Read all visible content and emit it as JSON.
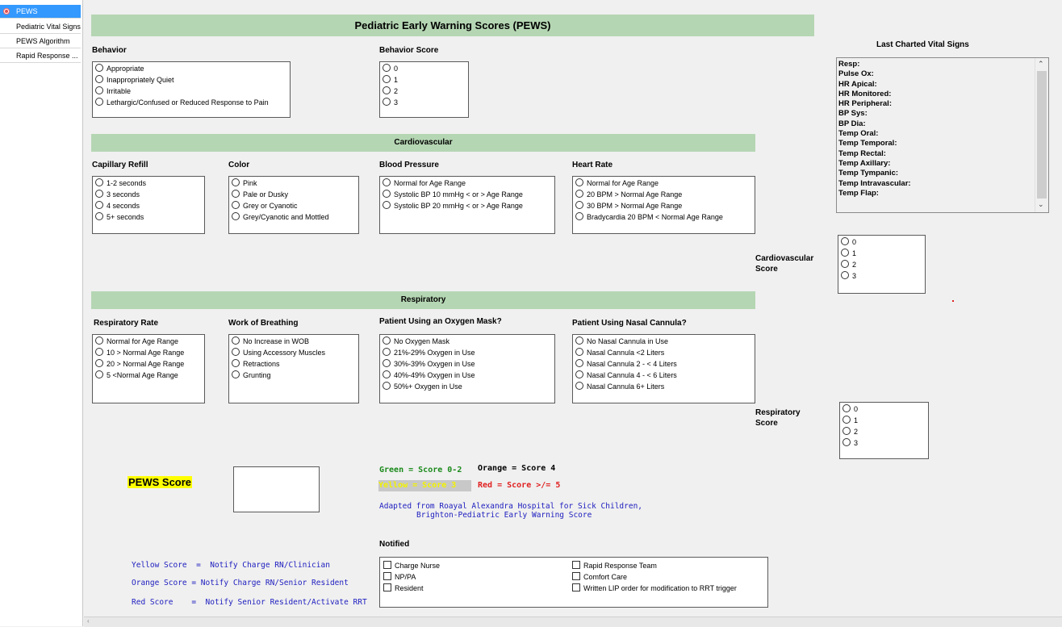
{
  "nav": {
    "items": [
      {
        "label": "PEWS",
        "active": true
      },
      {
        "label": "Pediatric Vital Signs"
      },
      {
        "label": "PEWS Algorithm"
      },
      {
        "label": "Rapid Response ..."
      }
    ]
  },
  "title": "Pediatric Early Warning Scores (PEWS)",
  "behavior": {
    "label": "Behavior",
    "options": [
      "Appropriate",
      "Inappropriately Quiet",
      "Irritable",
      "Lethargic/Confused or Reduced Response to Pain"
    ]
  },
  "behavior_score": {
    "label": "Behavior Score",
    "options": [
      "0",
      "1",
      "2",
      "3"
    ]
  },
  "cardio": {
    "banner": "Cardiovascular",
    "capillary": {
      "label": "Capillary Refill",
      "options": [
        "1-2 seconds",
        "3 seconds",
        "4 seconds",
        "5+ seconds"
      ]
    },
    "color": {
      "label": "Color",
      "options": [
        "Pink",
        "Pale or Dusky",
        "Grey or Cyanotic",
        "Grey/Cyanotic and Mottled"
      ]
    },
    "bp": {
      "label": "Blood Pressure",
      "options": [
        "Normal for Age Range",
        "Systolic BP 10 mmHg < or > Age Range",
        "Systolic BP 20 mmHg < or > Age Range"
      ]
    },
    "hr": {
      "label": "Heart Rate",
      "options": [
        "Normal for Age Range",
        "20 BPM > Normal Age Range",
        "30 BPM > Normal Age Range",
        "Bradycardia 20 BPM < Normal Age Range"
      ]
    },
    "score_label_1": "Cardiovascular",
    "score_label_2": "Score",
    "score_options": [
      "0",
      "1",
      "2",
      "3"
    ]
  },
  "resp": {
    "banner": "Respiratory",
    "rate": {
      "label": "Respiratory Rate",
      "options": [
        "Normal for Age Range",
        "10 > Normal Age Range",
        "20 > Normal Age Range",
        "5 <Normal Age Range"
      ]
    },
    "wob": {
      "label": "Work of Breathing",
      "options": [
        "No Increase in WOB",
        "Using Accessory Muscles",
        "Retractions",
        "Grunting"
      ]
    },
    "mask": {
      "label": "Patient Using an Oxygen Mask?",
      "options": [
        "No Oxygen Mask",
        "21%-29% Oxygen in Use",
        "30%-39% Oxygen in Use",
        "40%-49% Oxygen in Use",
        "50%+ Oxygen in Use"
      ]
    },
    "cannula": {
      "label": "Patient Using Nasal Cannula?",
      "options": [
        "No Nasal Cannula in Use",
        "Nasal Cannula <2 Liters",
        "Nasal Cannula 2 - < 4 Liters",
        "Nasal Cannula 4 - < 6 Liters",
        "Nasal Cannula 6+ Liters"
      ]
    },
    "score_label_1": "Respiratory",
    "score_label_2": "Score",
    "score_options": [
      "0",
      "1",
      "2",
      "3"
    ]
  },
  "vitals": {
    "title": "Last Charted Vital Signs",
    "items": [
      "Resp:",
      "Pulse Ox:",
      "HR Apical:",
      "HR Monitored:",
      "HR Peripheral:",
      "BP Sys:",
      "BP Dia:",
      "Temp Oral:",
      "Temp Temporal:",
      "Temp Rectal:",
      "Temp Axillary:",
      "Temp Tympanic:",
      "Temp Intravascular:",
      "Temp Flap:"
    ]
  },
  "pews_score": {
    "label": "PEWS Score",
    "value": ""
  },
  "legend": {
    "green": "Green = Score 0-2",
    "orange": "Orange = Score 4",
    "yellow": "Yellow = Score 3",
    "red": "Red = Score >/= 5",
    "colors": {
      "green": "#1a8a1a",
      "red": "#e02020",
      "yellow_bg": "#c8c8c8",
      "yellow_text": "#f2f200"
    }
  },
  "adapted": {
    "line1": "Adapted from Roayal Alexandra Hospital for Sick Children,",
    "line2": "Brighton-Pediatric Early Warning Score"
  },
  "notify_rules": [
    "Yellow Score  =  Notify Charge RN/Clinician",
    "Orange Score = Notify Charge RN/Senior Resident",
    "Red Score    =  Notify Senior Resident/Activate RRT"
  ],
  "notified": {
    "label": "Notified",
    "left": [
      "Charge Nurse",
      "NP/PA",
      "Resident"
    ],
    "right": [
      "Rapid Response Team",
      "Comfort Care",
      "Written LIP order for modification to RRT trigger"
    ]
  }
}
